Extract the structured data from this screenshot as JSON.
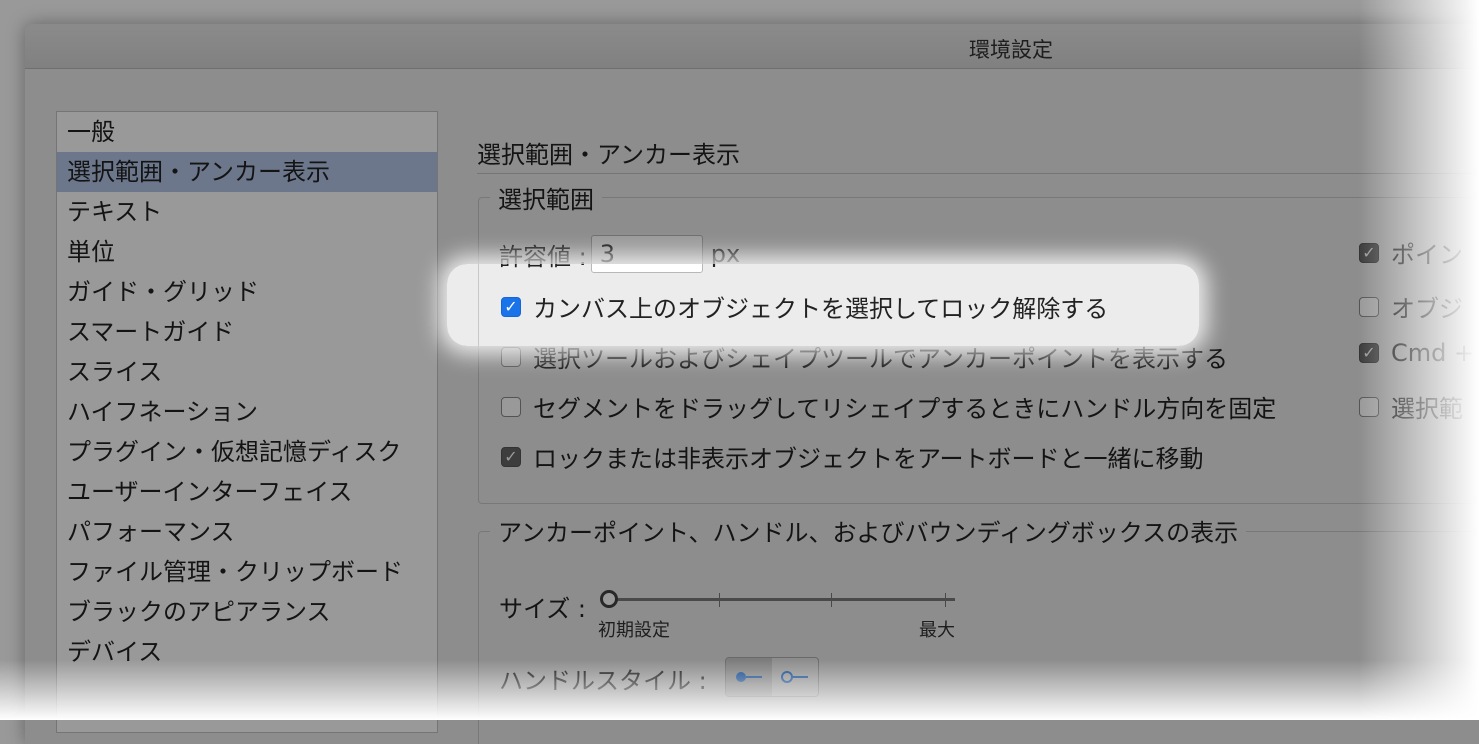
{
  "window": {
    "title": "環境設定"
  },
  "sidebar": {
    "items": [
      {
        "label": "一般"
      },
      {
        "label": "選択範囲・アンカー表示",
        "selected": true
      },
      {
        "label": "テキスト"
      },
      {
        "label": "単位"
      },
      {
        "label": "ガイド・グリッド"
      },
      {
        "label": "スマートガイド"
      },
      {
        "label": "スライス"
      },
      {
        "label": "ハイフネーション"
      },
      {
        "label": "プラグイン・仮想記憶ディスク"
      },
      {
        "label": "ユーザーインターフェイス"
      },
      {
        "label": "パフォーマンス"
      },
      {
        "label": "ファイル管理・クリップボード"
      },
      {
        "label": "ブラックのアピアランス"
      },
      {
        "label": "デバイス"
      }
    ]
  },
  "main": {
    "section_title": "選択範囲・アンカー表示",
    "selection_group": {
      "legend": "選択範囲",
      "tolerance_label": "許容値 :",
      "tolerance_value": "3",
      "tolerance_unit": "px",
      "options": [
        {
          "label": "カンバス上のオブジェクトを選択してロック解除する",
          "checked": true
        },
        {
          "label": "選択ツールおよびシェイプツールでアンカーポイントを表示する",
          "checked": false
        },
        {
          "label": "セグメントをドラッグしてリシェイプするときにハンドル方向を固定",
          "checked": false
        },
        {
          "label": "ロックまたは非表示オブジェクトをアートボードと一緒に移動",
          "checked": true
        }
      ],
      "right_options": [
        {
          "label": "ポイン",
          "checked": true
        },
        {
          "label": "オブジ",
          "checked": false
        },
        {
          "label": "Cmd +",
          "checked": true
        },
        {
          "label": "選択範",
          "checked": false
        }
      ]
    },
    "anchor_group": {
      "legend": "アンカーポイント、ハンドル、およびバウンディングボックスの表示",
      "size_label": "サイズ :",
      "slider_min_label": "初期設定",
      "slider_max_label": "最大",
      "slider_value": 0,
      "handle_style_label": "ハンドルスタイル :"
    }
  },
  "colors": {
    "checkbox_accent": "#1a73e8",
    "selected_row": "#b4c7ea"
  }
}
